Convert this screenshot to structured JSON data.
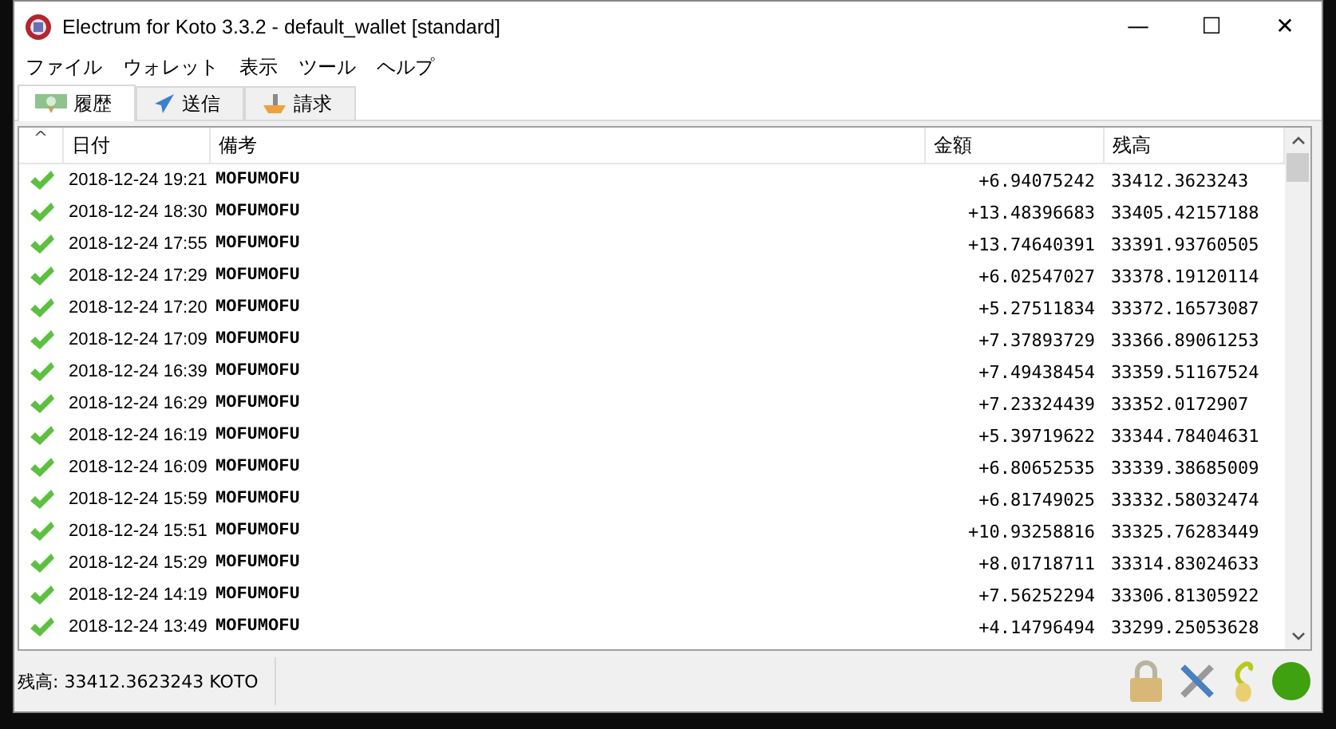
{
  "window": {
    "title": "Electrum for Koto 3.3.2  -  default_wallet  [standard]",
    "controls": [
      "—",
      "☐",
      "✕"
    ]
  },
  "menu": [
    "ファイル",
    "ウォレット",
    "表示",
    "ツール",
    "ヘルプ"
  ],
  "tabs": [
    {
      "label": "履歴",
      "selected": true
    },
    {
      "label": "送信",
      "selected": false
    },
    {
      "label": "請求",
      "selected": false
    }
  ],
  "table": {
    "sort_mark": "^",
    "columns": [
      "日付",
      "備考",
      "金額",
      "残高"
    ],
    "rows": [
      {
        "confirmed": true,
        "date": "2018-12-24 19:21",
        "memo": "MOFUMOFU",
        "amount": "+6.94075242",
        "balance": "33412.3623243"
      },
      {
        "confirmed": true,
        "date": "2018-12-24 18:30",
        "memo": "MOFUMOFU",
        "amount": "+13.48396683",
        "balance": "33405.42157188"
      },
      {
        "confirmed": true,
        "date": "2018-12-24 17:55",
        "memo": "MOFUMOFU",
        "amount": "+13.74640391",
        "balance": "33391.93760505"
      },
      {
        "confirmed": true,
        "date": "2018-12-24 17:29",
        "memo": "MOFUMOFU",
        "amount": "+6.02547027",
        "balance": "33378.19120114"
      },
      {
        "confirmed": true,
        "date": "2018-12-24 17:20",
        "memo": "MOFUMOFU",
        "amount": "+5.27511834",
        "balance": "33372.16573087"
      },
      {
        "confirmed": true,
        "date": "2018-12-24 17:09",
        "memo": "MOFUMOFU",
        "amount": "+7.37893729",
        "balance": "33366.89061253"
      },
      {
        "confirmed": true,
        "date": "2018-12-24 16:39",
        "memo": "MOFUMOFU",
        "amount": "+7.49438454",
        "balance": "33359.51167524"
      },
      {
        "confirmed": true,
        "date": "2018-12-24 16:29",
        "memo": "MOFUMOFU",
        "amount": "+7.23324439",
        "balance": "33352.0172907"
      },
      {
        "confirmed": true,
        "date": "2018-12-24 16:19",
        "memo": "MOFUMOFU",
        "amount": "+5.39719622",
        "balance": "33344.78404631"
      },
      {
        "confirmed": true,
        "date": "2018-12-24 16:09",
        "memo": "MOFUMOFU",
        "amount": "+6.80652535",
        "balance": "33339.38685009"
      },
      {
        "confirmed": true,
        "date": "2018-12-24 15:59",
        "memo": "MOFUMOFU",
        "amount": "+6.81749025",
        "balance": "33332.58032474"
      },
      {
        "confirmed": true,
        "date": "2018-12-24 15:51",
        "memo": "MOFUMOFU",
        "amount": "+10.93258816",
        "balance": "33325.76283449"
      },
      {
        "confirmed": true,
        "date": "2018-12-24 15:29",
        "memo": "MOFUMOFU",
        "amount": "+8.01718711",
        "balance": "33314.83024633"
      },
      {
        "confirmed": true,
        "date": "2018-12-24 14:19",
        "memo": "MOFUMOFU",
        "amount": "+7.56252294",
        "balance": "33306.81305922"
      },
      {
        "confirmed": true,
        "date": "2018-12-24 13:49",
        "memo": "MOFUMOFU",
        "amount": "+4.14796494",
        "balance": "33299.25053628"
      }
    ]
  },
  "status_bar": {
    "balance": "残高: 33412.3623243 KOTO",
    "connected": true
  }
}
